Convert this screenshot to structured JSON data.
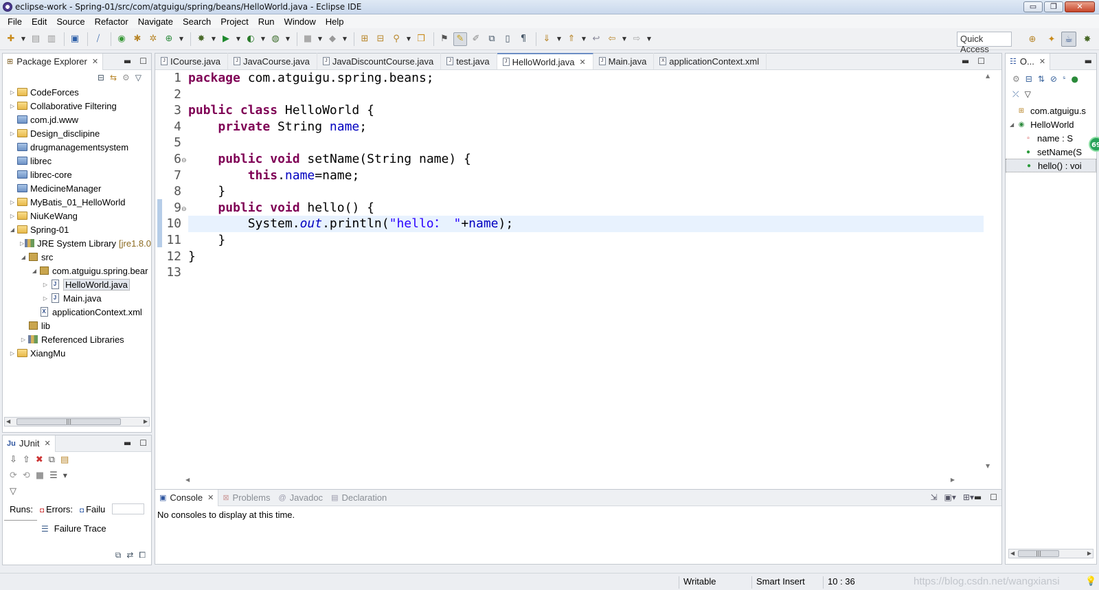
{
  "window": {
    "title": "eclipse-work - Spring-01/src/com/atguigu/spring/beans/HelloWorld.java - Eclipse IDE",
    "buttons": [
      "▭",
      "❐",
      "✕"
    ]
  },
  "menu": [
    "File",
    "Edit",
    "Source",
    "Refactor",
    "Navigate",
    "Search",
    "Project",
    "Run",
    "Window",
    "Help"
  ],
  "toolbar": {
    "quick_access": "Quick Access"
  },
  "package_explorer": {
    "tab": "Package Explorer",
    "tree": [
      {
        "label": "CodeForces",
        "depth": 0,
        "twisty": "▷",
        "icon": "project"
      },
      {
        "label": "Collaborative Filtering",
        "depth": 0,
        "twisty": "▷",
        "icon": "project"
      },
      {
        "label": "com.jd.www",
        "depth": 0,
        "twisty": "",
        "icon": "folder"
      },
      {
        "label": "Design_disclipine",
        "depth": 0,
        "twisty": "▷",
        "icon": "project"
      },
      {
        "label": "drugmanagementsystem",
        "depth": 0,
        "twisty": "",
        "icon": "folder"
      },
      {
        "label": "librec",
        "depth": 0,
        "twisty": "",
        "icon": "folder"
      },
      {
        "label": "librec-core",
        "depth": 0,
        "twisty": "",
        "icon": "folder"
      },
      {
        "label": "MedicineManager",
        "depth": 0,
        "twisty": "",
        "icon": "folder"
      },
      {
        "label": "MyBatis_01_HelloWorld",
        "depth": 0,
        "twisty": "▷",
        "icon": "project"
      },
      {
        "label": "NiuKeWang",
        "depth": 0,
        "twisty": "▷",
        "icon": "project"
      },
      {
        "label": "Spring-01",
        "depth": 0,
        "twisty": "◢",
        "icon": "project"
      },
      {
        "label": "JRE System Library",
        "decor": "[jre1.8.0",
        "depth": 1,
        "twisty": "▷",
        "icon": "library"
      },
      {
        "label": "src",
        "depth": 1,
        "twisty": "◢",
        "icon": "package"
      },
      {
        "label": "com.atguigu.spring.bear",
        "depth": 2,
        "twisty": "◢",
        "icon": "package"
      },
      {
        "label": "HelloWorld.java",
        "depth": 3,
        "twisty": "▷",
        "icon": "java",
        "selected": true
      },
      {
        "label": "Main.java",
        "depth": 3,
        "twisty": "▷",
        "icon": "java"
      },
      {
        "label": "applicationContext.xml",
        "depth": 2,
        "twisty": "",
        "icon": "xml"
      },
      {
        "label": "lib",
        "depth": 1,
        "twisty": "",
        "icon": "package"
      },
      {
        "label": "Referenced Libraries",
        "depth": 1,
        "twisty": "▷",
        "icon": "library"
      },
      {
        "label": "XiangMu",
        "depth": 0,
        "twisty": "▷",
        "icon": "project"
      }
    ]
  },
  "junit": {
    "tab": "JUnit",
    "runs_label": "Runs:",
    "errors_label": "Errors:",
    "failures_label": "Failu",
    "failure_trace": "Failure Trace"
  },
  "editor": {
    "tabs": [
      {
        "label": "ICourse.java",
        "active": false
      },
      {
        "label": "JavaCourse.java",
        "active": false
      },
      {
        "label": "JavaDiscountCourse.java",
        "active": false
      },
      {
        "label": "test.java",
        "active": false
      },
      {
        "label": "HelloWorld.java",
        "active": true
      },
      {
        "label": "Main.java",
        "active": false
      },
      {
        "label": "applicationContext.xml",
        "active": false
      }
    ],
    "line_numbers": [
      "1",
      "2",
      "3",
      "4",
      "5",
      "6",
      "7",
      "8",
      "9",
      "10",
      "11",
      "12",
      "13"
    ]
  },
  "console": {
    "tabs": [
      "Console",
      "Problems",
      "Javadoc",
      "Declaration"
    ],
    "message": "No consoles to display at this time."
  },
  "outline": {
    "tab": "O...",
    "items": [
      {
        "label": "com.atguigu.s",
        "icon": "package",
        "indent": 1
      },
      {
        "label": "HelloWorld",
        "icon": "class",
        "indent": 0
      },
      {
        "label": "name : S",
        "icon": "private-field",
        "indent": 2
      },
      {
        "label": "setName(S",
        "icon": "public-method",
        "indent": 2
      },
      {
        "label": "hello() : voi",
        "icon": "public-method",
        "indent": 2,
        "selected": true
      }
    ],
    "badge": "69"
  },
  "status": {
    "writable": "Writable",
    "insert_mode": "Smart Insert",
    "position": "10 : 36",
    "watermark": "https://blog.csdn.net/wangxiansi"
  },
  "colors": {
    "keyword": "#7f0055",
    "field": "#0000c0",
    "string": "#2a00ff",
    "current_line": "#e8f2fe"
  }
}
